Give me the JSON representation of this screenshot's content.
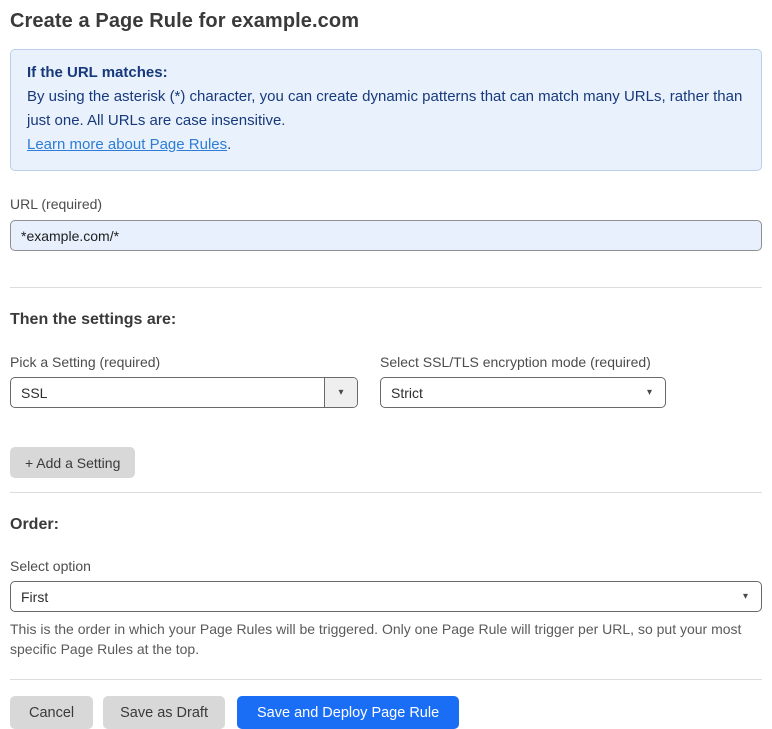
{
  "page": {
    "title": "Create a Page Rule for example.com"
  },
  "info_box": {
    "heading": "If the URL matches:",
    "body": "By using the asterisk (*) character, you can create dynamic patterns that can match many URLs, rather than just one. All URLs are case insensitive.",
    "link_label": "Learn more about Page Rules",
    "link_suffix": "."
  },
  "url_field": {
    "label": "URL (required)",
    "value": "*example.com/*"
  },
  "settings_section": {
    "heading": "Then the settings are:",
    "setting_picker": {
      "label": "Pick a Setting (required)",
      "value": "SSL"
    },
    "ssl_mode_picker": {
      "label": "Select SSL/TLS encryption mode (required)",
      "value": "Strict"
    },
    "add_setting_label": "+ Add a Setting"
  },
  "order_section": {
    "heading": "Order:",
    "select_label": "Select option",
    "select_value": "First",
    "help_text": "This is the order in which your Page Rules will be triggered. Only one Page Rule will trigger per URL, so put your most specific Page Rules at the top."
  },
  "actions": {
    "cancel_label": "Cancel",
    "save_draft_label": "Save as Draft",
    "save_deploy_label": "Save and Deploy Page Rule"
  },
  "icons": {
    "dropdown_arrow": "▾"
  },
  "colors": {
    "primary_button": "#1a6ef5",
    "info_background": "#e9f2fc",
    "info_border": "#bad0ea",
    "info_text": "#17397c",
    "link": "#2e7cd5",
    "input_background": "#e8f0fe"
  }
}
